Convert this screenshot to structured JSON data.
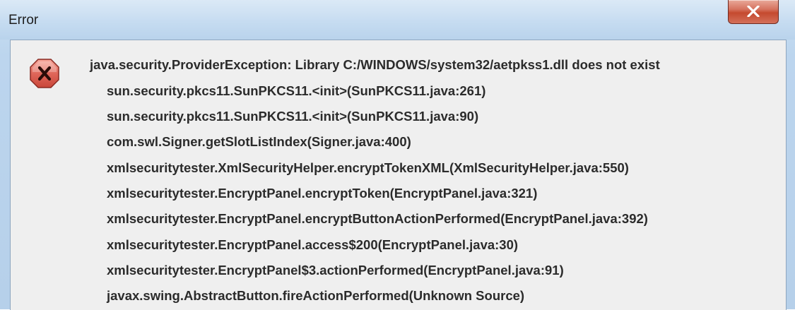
{
  "window": {
    "title": "Error",
    "close_icon": "close-icon"
  },
  "dialog": {
    "icon": "error-icon",
    "exception": "java.security.ProviderException: Library C:/WINDOWS/system32/aetpkss1.dll does not exist",
    "stack_trace": [
      "sun.security.pkcs11.SunPKCS11.<init>(SunPKCS11.java:261)",
      "sun.security.pkcs11.SunPKCS11.<init>(SunPKCS11.java:90)",
      "com.swl.Signer.getSlotListIndex(Signer.java:400)",
      "xmlsecuritytester.XmlSecurityHelper.encryptTokenXML(XmlSecurityHelper.java:550)",
      "xmlsecuritytester.EncryptPanel.encryptToken(EncryptPanel.java:321)",
      "xmlsecuritytester.EncryptPanel.encryptButtonActionPerformed(EncryptPanel.java:392)",
      "xmlsecuritytester.EncryptPanel.access$200(EncryptPanel.java:30)",
      "xmlsecuritytester.EncryptPanel$3.actionPerformed(EncryptPanel.java:91)",
      "javax.swing.AbstractButton.fireActionPerformed(Unknown Source)"
    ]
  },
  "colors": {
    "close_button": "#c54a2f",
    "error_icon_fill": "#e0675a",
    "text": "#2b2b2b",
    "content_bg": "#efefef"
  }
}
